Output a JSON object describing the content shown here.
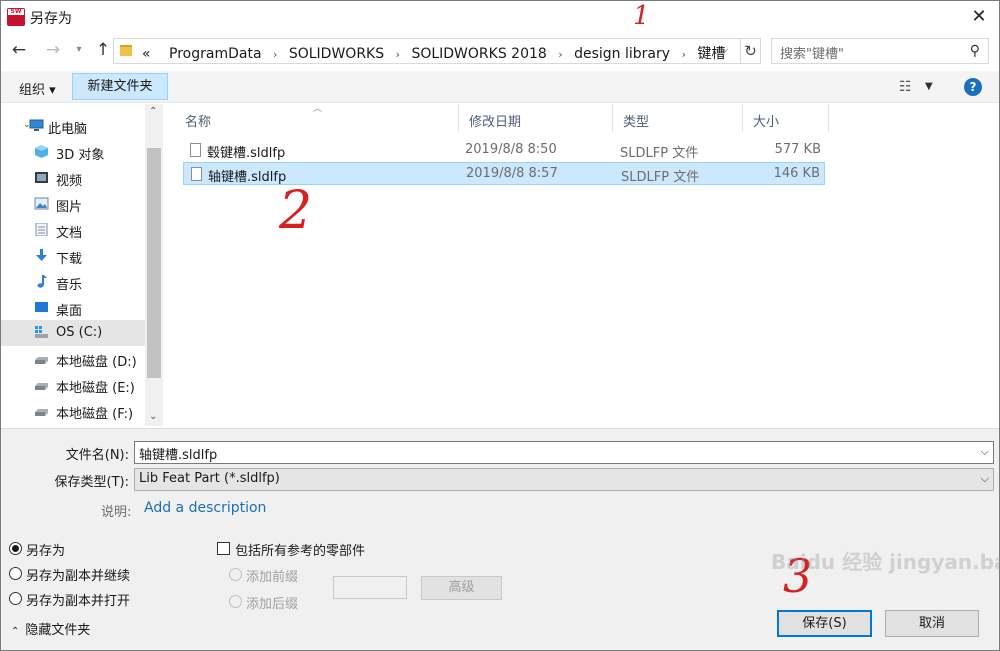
{
  "window": {
    "title": "另存为",
    "close_glyph": "✕",
    "app_icon_text": "SW"
  },
  "address_bar": {
    "overflow": "«",
    "breadcrumbs": [
      "ProgramData",
      "SOLIDWORKS",
      "SOLIDWORKS 2018",
      "design library",
      "键槽"
    ],
    "separator": "›"
  },
  "search": {
    "placeholder": "搜索\"键槽\""
  },
  "toolbar": {
    "organize_label": "组织 ▾",
    "new_folder_label": "新建文件夹"
  },
  "nav_pane": {
    "items": [
      {
        "label": "此电脑",
        "icon": "monitor-icon"
      },
      {
        "label": "3D 对象",
        "icon": "cube-icon"
      },
      {
        "label": "视频",
        "icon": "video-icon"
      },
      {
        "label": "图片",
        "icon": "picture-icon"
      },
      {
        "label": "文档",
        "icon": "document-icon"
      },
      {
        "label": "下载",
        "icon": "download-icon"
      },
      {
        "label": "音乐",
        "icon": "music-icon"
      },
      {
        "label": "桌面",
        "icon": "desktop-icon"
      },
      {
        "label": "OS (C:)",
        "icon": "system-drive-icon"
      },
      {
        "label": "本地磁盘 (D:)",
        "icon": "drive-icon"
      },
      {
        "label": "本地磁盘 (E:)",
        "icon": "drive-icon"
      },
      {
        "label": "本地磁盘 (F:)",
        "icon": "drive-icon"
      }
    ],
    "selected": "OS (C:)"
  },
  "file_list": {
    "columns": [
      "名称",
      "修改日期",
      "类型",
      "大小"
    ],
    "rows": [
      {
        "name": "毂键槽.sldlfp",
        "date": "2019/8/8 8:50",
        "type": "SLDLFP 文件",
        "size": "577 KB",
        "selected": false
      },
      {
        "name": "轴键槽.sldlfp",
        "date": "2019/8/8 8:57",
        "type": "SLDLFP 文件",
        "size": "146 KB",
        "selected": true
      }
    ]
  },
  "form": {
    "filename_label": "文件名(N):",
    "filename_value": "轴键槽.sldlfp",
    "filetype_label": "保存类型(T):",
    "filetype_value": "Lib Feat Part (*.sldlfp)",
    "description_label": "说明:",
    "description_link": "Add a description",
    "save_options": [
      {
        "label": "另存为",
        "checked": true
      },
      {
        "label": "另存为副本并继续",
        "checked": false
      },
      {
        "label": "另存为副本并打开",
        "checked": false
      }
    ],
    "include_refs_label": "包括所有参考的零部件",
    "prefix_label": "添加前缀",
    "suffix_label": "添加后缀",
    "advanced_label": "高级",
    "hide_folders_label": "隐藏文件夹",
    "save_label": "保存(S)",
    "cancel_label": "取消"
  },
  "annotations": [
    "1",
    "2",
    "3"
  ],
  "watermark": "Baidu 经验 jingyan.baidu.com",
  "colors": {
    "selection_bg": "#cce8ff",
    "selection_border": "#99d1ff",
    "link": "#1c6fb8",
    "default_button_border": "#0078d7",
    "annotation": "#d62020"
  }
}
